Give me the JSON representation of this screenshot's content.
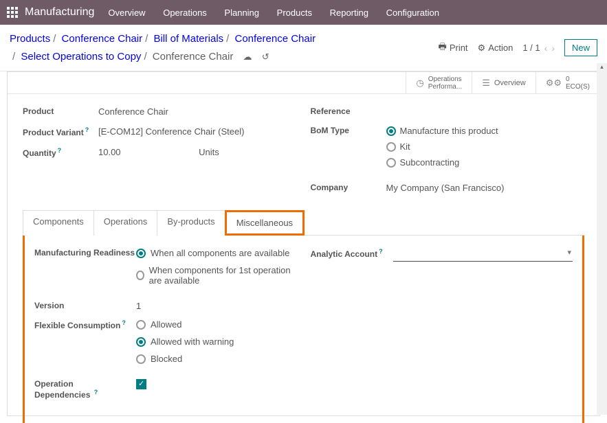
{
  "nav": {
    "brand": "Manufacturing",
    "items": [
      "Overview",
      "Operations",
      "Planning",
      "Products",
      "Reporting",
      "Configuration"
    ]
  },
  "breadcrumbs": {
    "parts": [
      "Products",
      "Conference Chair",
      "Bill of Materials",
      "Conference Chair",
      "Select Operations to Copy"
    ],
    "current": "Conference Chair"
  },
  "controls": {
    "print": "Print",
    "action": "Action",
    "pager": "1 / 1",
    "new": "New"
  },
  "stat_buttons": {
    "operations": {
      "line1": "Operations",
      "line2": "Performa..."
    },
    "overview": "Overview",
    "eco": {
      "count": "0",
      "label": "ECO(S)"
    }
  },
  "form": {
    "left": {
      "product": {
        "label": "Product",
        "value": "Conference Chair"
      },
      "variant": {
        "label": "Product Variant",
        "value": "[E-COM12] Conference Chair (Steel)"
      },
      "quantity": {
        "label": "Quantity",
        "value": "10.00",
        "unit": "Units"
      }
    },
    "right": {
      "reference": {
        "label": "Reference"
      },
      "bom_type": {
        "label": "BoM Type",
        "options": [
          "Manufacture this product",
          "Kit",
          "Subcontracting"
        ],
        "selected": 0
      },
      "company": {
        "label": "Company",
        "value": "My Company (San Francisco)"
      }
    }
  },
  "tabs": {
    "items": [
      "Components",
      "Operations",
      "By-products",
      "Miscellaneous"
    ],
    "active": 3
  },
  "misc": {
    "readiness": {
      "label": "Manufacturing Readiness",
      "options": [
        "When all components are available",
        "When components for 1st operation are available"
      ],
      "selected": 0
    },
    "version": {
      "label": "Version",
      "value": "1"
    },
    "flex": {
      "label": "Flexible Consumption",
      "options": [
        "Allowed",
        "Allowed with warning",
        "Blocked"
      ],
      "selected": 1
    },
    "opdep": {
      "label1": "Operation",
      "label2": "Dependencies",
      "checked": true
    },
    "analytic": {
      "label": "Analytic Account",
      "value": ""
    }
  }
}
